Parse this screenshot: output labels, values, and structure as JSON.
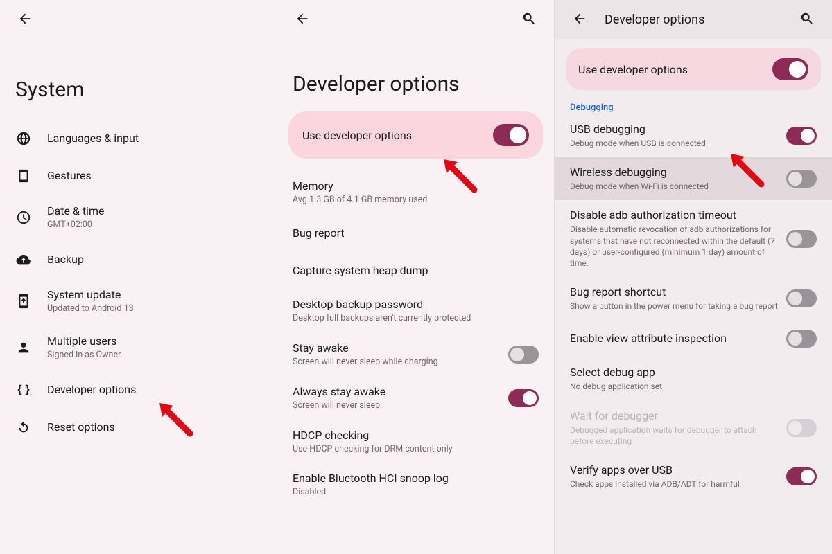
{
  "panel1": {
    "title": "System",
    "items": [
      {
        "title": "Languages & input",
        "sub": ""
      },
      {
        "title": "Gestures",
        "sub": ""
      },
      {
        "title": "Date & time",
        "sub": "GMT+02:00"
      },
      {
        "title": "Backup",
        "sub": ""
      },
      {
        "title": "System update",
        "sub": "Updated to Android 13"
      },
      {
        "title": "Multiple users",
        "sub": "Signed in as Owner"
      },
      {
        "title": "Developer options",
        "sub": ""
      },
      {
        "title": "Reset options",
        "sub": ""
      }
    ]
  },
  "panel2": {
    "title": "Developer options",
    "banner_label": "Use developer options",
    "banner_on": true,
    "items": [
      {
        "title": "Memory",
        "sub": "Avg 1.3 GB of 4.1 GB memory used",
        "toggle": null
      },
      {
        "title": "Bug report",
        "sub": "",
        "toggle": null
      },
      {
        "title": "Capture system heap dump",
        "sub": "",
        "toggle": null
      },
      {
        "title": "Desktop backup password",
        "sub": "Desktop full backups aren't currently protected",
        "toggle": null
      },
      {
        "title": "Stay awake",
        "sub": "Screen will never sleep while charging",
        "toggle": false
      },
      {
        "title": "Always stay awake",
        "sub": "Screen will never sleep",
        "toggle": true
      },
      {
        "title": "HDCP checking",
        "sub": "Use HDCP checking for DRM content only",
        "toggle": null
      },
      {
        "title": "Enable Bluetooth HCI snoop log",
        "sub": "Disabled",
        "toggle": null
      }
    ]
  },
  "panel3": {
    "topbar_title": "Developer options",
    "banner_label": "Use developer options",
    "banner_on": true,
    "section_label": "Debugging",
    "items": [
      {
        "title": "USB debugging",
        "sub": "Debug mode when USB is connected",
        "toggle": true,
        "highlight": false,
        "disabled": false
      },
      {
        "title": "Wireless debugging",
        "sub": "Debug mode when Wi-Fi is connected",
        "toggle": false,
        "highlight": true,
        "disabled": false
      },
      {
        "title": "Disable adb authorization timeout",
        "sub": "Disable automatic revocation of adb authorizations for systems that have not reconnected within the default (7 days) or user-configured (minimum 1 day) amount of time.",
        "toggle": false,
        "highlight": false,
        "disabled": false
      },
      {
        "title": "Bug report shortcut",
        "sub": "Show a button in the power menu for taking a bug report",
        "toggle": false,
        "highlight": false,
        "disabled": false
      },
      {
        "title": "Enable view attribute inspection",
        "sub": "",
        "toggle": false,
        "highlight": false,
        "disabled": false
      },
      {
        "title": "Select debug app",
        "sub": "No debug application set",
        "toggle": null,
        "highlight": false,
        "disabled": false
      },
      {
        "title": "Wait for debugger",
        "sub": "Debugged application waits for debugger to attach before executing",
        "toggle": false,
        "highlight": false,
        "disabled": true
      },
      {
        "title": "Verify apps over USB",
        "sub": "Check apps installed via ADB/ADT for harmful",
        "toggle": true,
        "highlight": false,
        "disabled": false
      }
    ]
  }
}
